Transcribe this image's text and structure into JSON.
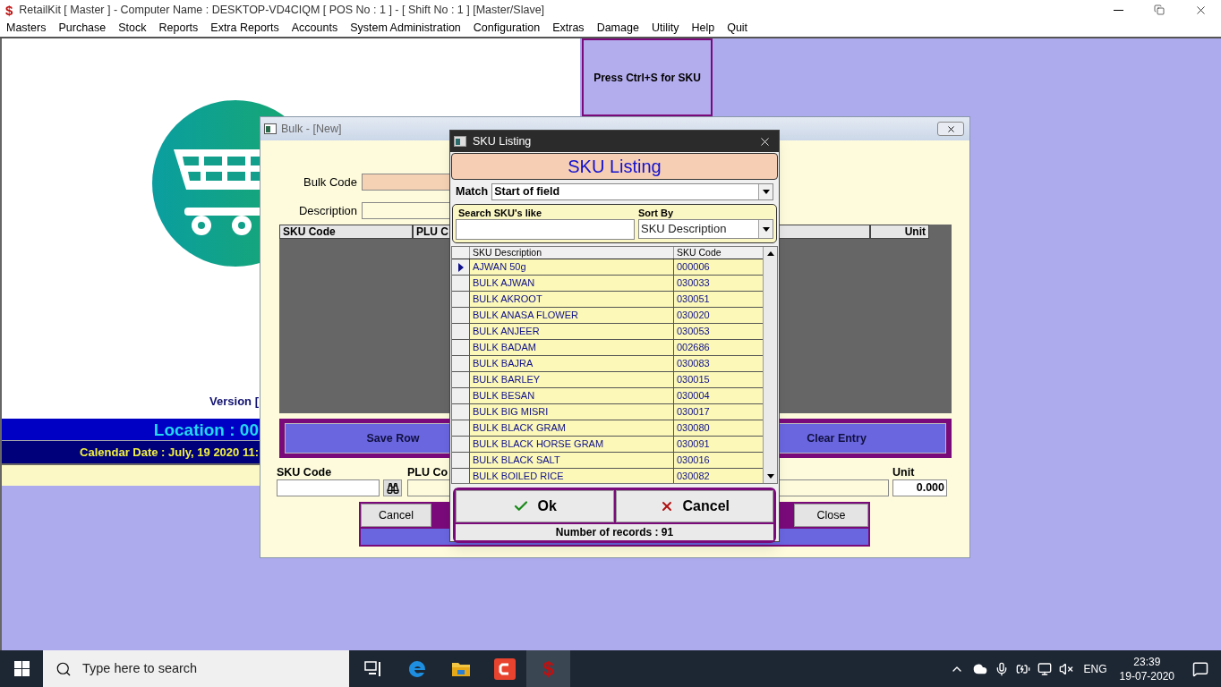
{
  "window": {
    "icon_glyph": "$",
    "title": "RetailKit [ Master ] - Computer Name : DESKTOP-VD4CIQM [ POS No : 1 ] - [ Shift No : 1 ]  [Master/Slave]"
  },
  "menu": [
    "Masters",
    "Purchase",
    "Stock",
    "Reports",
    "Extra Reports",
    "Accounts",
    "System Administration",
    "Configuration",
    "Extras",
    "Damage",
    "Utility",
    "Help",
    "Quit"
  ],
  "main_panel": {
    "version": "Version [",
    "location": "Location : 00",
    "calendar_date": "Calendar Date : July, 19 2020 11:"
  },
  "sku_hint": "Press Ctrl+S for SKU",
  "bulk_window": {
    "title": "Bulk  - [New]",
    "fields": [
      {
        "label": "Bulk Code",
        "kind": "required"
      },
      {
        "label": "Description",
        "kind": "plain"
      }
    ],
    "grid_columns": [
      "SKU Code",
      "PLU C",
      "Unit"
    ],
    "row_buttons": [
      "Save Row",
      "Clear Entry"
    ],
    "entry": {
      "sku_label": "SKU Code",
      "plu_label": "PLU Co",
      "unit_label": "Unit",
      "unit_value": "0.000"
    },
    "buttons": [
      "Cancel",
      "Close"
    ]
  },
  "sku_dialog": {
    "title": "SKU Listing",
    "heading": "SKU Listing",
    "match_label": "Match",
    "match_value": "Start of field",
    "search_label": "Search SKU's like",
    "sort_label": "Sort By",
    "sort_value": "SKU Description",
    "columns": [
      "SKU Description",
      "SKU Code"
    ],
    "rows": [
      {
        "description": "AJWAN 50g",
        "code": "000006",
        "selected": true
      },
      {
        "description": "BULK AJWAN",
        "code": "030033",
        "selected": false
      },
      {
        "description": "BULK AKROOT",
        "code": "030051",
        "selected": false
      },
      {
        "description": "BULK ANASA FLOWER",
        "code": "030020",
        "selected": false
      },
      {
        "description": "BULK ANJEER",
        "code": "030053",
        "selected": false
      },
      {
        "description": "BULK BADAM",
        "code": "002686",
        "selected": false
      },
      {
        "description": "BULK BAJRA",
        "code": "030083",
        "selected": false
      },
      {
        "description": "BULK BARLEY",
        "code": "030015",
        "selected": false
      },
      {
        "description": "BULK BESAN",
        "code": "030004",
        "selected": false
      },
      {
        "description": "BULK BIG MISRI",
        "code": "030017",
        "selected": false
      },
      {
        "description": "BULK BLACK GRAM",
        "code": "030080",
        "selected": false
      },
      {
        "description": "BULK BLACK HORSE GRAM",
        "code": "030091",
        "selected": false
      },
      {
        "description": "BULK BLACK SALT",
        "code": "030016",
        "selected": false
      },
      {
        "description": "BULK BOILED RICE",
        "code": "030082",
        "selected": false
      }
    ],
    "ok": "Ok",
    "cancel": "Cancel",
    "records": "Number of records : 91"
  },
  "taskbar": {
    "search_placeholder": "Type here to search",
    "apps": [
      {
        "kind": "taskview",
        "selected": false
      },
      {
        "kind": "browser",
        "selected": false
      },
      {
        "kind": "folder",
        "selected": false
      },
      {
        "kind": "capture",
        "selected": false
      },
      {
        "kind": "retail",
        "glyph": "$",
        "selected": true
      }
    ],
    "language": "ENG",
    "time": "23:39",
    "date": "19-07-2020"
  }
}
